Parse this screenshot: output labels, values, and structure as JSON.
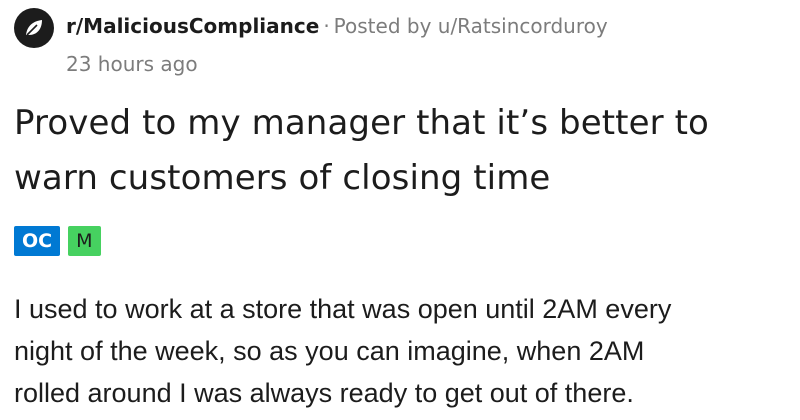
{
  "header": {
    "subreddit": "r/MaliciousCompliance",
    "separator": "·",
    "posted_by_prefix": "Posted by",
    "username": "u/Ratsincorduroy",
    "time_ago": "23 hours ago",
    "icon": "subreddit-avatar-icon"
  },
  "post": {
    "title_lines": [
      "Proved to my manager that it’s better to",
      "warn customers of closing time"
    ],
    "flairs": [
      {
        "label": "OC",
        "color": "#0079d3"
      },
      {
        "label": "M",
        "color": "#46d160"
      }
    ],
    "body_lines": [
      "I used to work at a store that was open until 2AM every",
      "night of the week, so as you can imagine, when 2AM",
      "rolled around I was always ready to get out of there."
    ]
  },
  "colors": {
    "text": "#1c1c1c",
    "meta": "#7c7c7c",
    "background": "#ffffff"
  }
}
